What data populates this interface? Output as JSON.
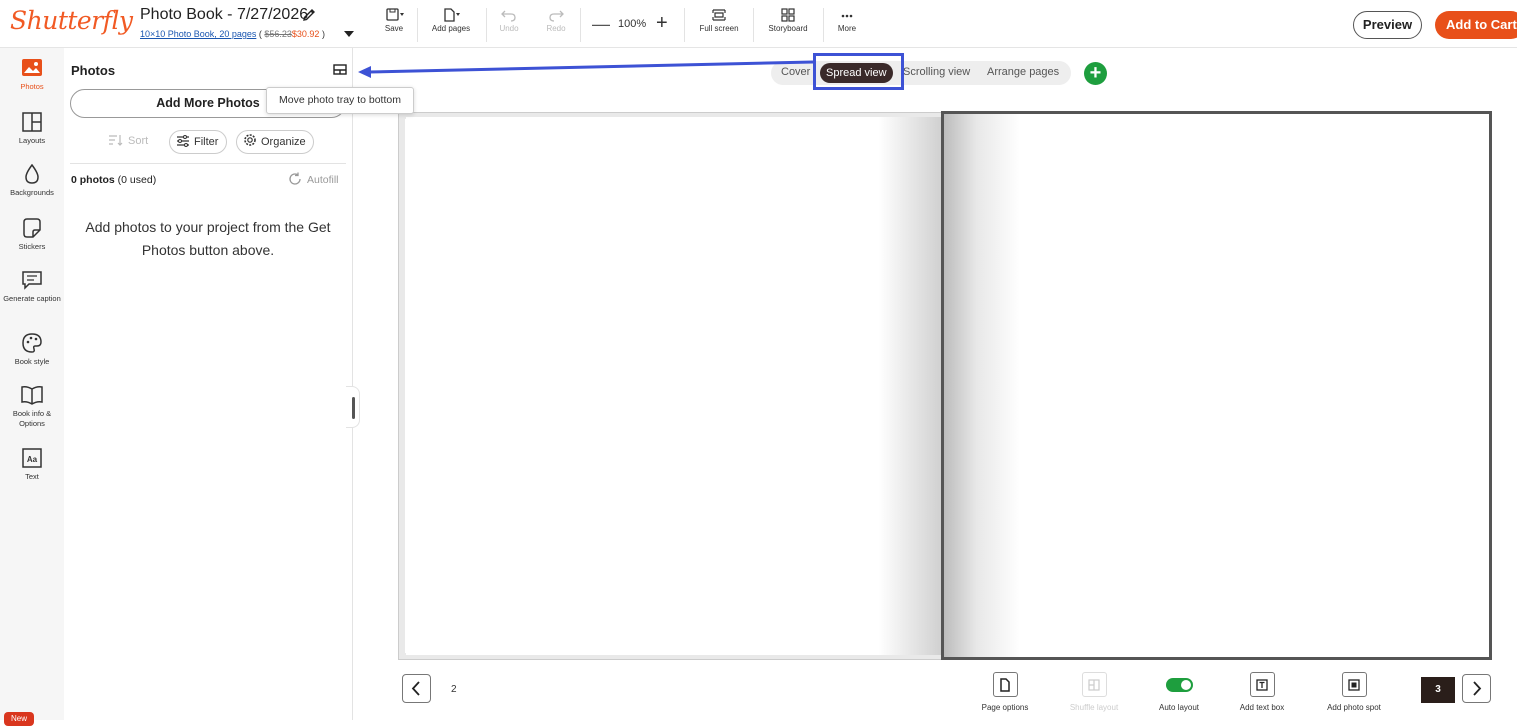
{
  "header": {
    "logo": "Shutterfly",
    "title": "Photo Book - 7/27/2026",
    "product_link": "10×10 Photo Book, 20 pages",
    "original_price": "$56.23",
    "sale_price": "$30.92",
    "tools": {
      "save": "Save",
      "add_pages": "Add pages",
      "undo": "Undo",
      "redo": "Redo",
      "zoom": "100%",
      "full_screen": "Full screen",
      "storyboard": "Storyboard",
      "more": "More"
    },
    "preview": "Preview",
    "add_to_cart": "Add to Cart"
  },
  "rail": {
    "items": [
      {
        "label": "Photos",
        "icon": "photos-icon",
        "active": true
      },
      {
        "label": "Layouts",
        "icon": "layouts-icon"
      },
      {
        "label": "Backgrounds",
        "icon": "drop-icon"
      },
      {
        "label": "Stickers",
        "icon": "sticker-icon"
      },
      {
        "label": "Generate caption",
        "icon": "caption-icon"
      },
      {
        "label": "Book style",
        "icon": "palette-icon"
      },
      {
        "label": "Book info & Options",
        "icon": "book-icon"
      },
      {
        "label": "Text",
        "icon": "text-icon"
      }
    ],
    "new_badge": "New"
  },
  "panel": {
    "title": "Photos",
    "add_more": "Add More Photos",
    "tooltip": "Move photo tray to bottom",
    "sort": "Sort",
    "filter": "Filter",
    "organize": "Organize",
    "count_bold": "0 photos",
    "count_rest": "(0 used)",
    "autofill": "Autofill",
    "empty_message": "Add photos to your project from the Get Photos button above."
  },
  "views": {
    "cover": "Cover",
    "spread": "Spread view",
    "scrolling": "Scrolling view",
    "arrange": "Arrange pages"
  },
  "footer": {
    "left_page": "2",
    "current_page": "3",
    "page_options": "Page options",
    "shuffle_layout": "Shuffle layout",
    "auto_layout": "Auto layout",
    "add_text_box": "Add text box",
    "add_photo_spot": "Add photo spot"
  },
  "colors": {
    "brand": "#f15a24",
    "cart": "#e8501a",
    "green": "#1e9e3e",
    "highlight": "#3d52d5"
  }
}
